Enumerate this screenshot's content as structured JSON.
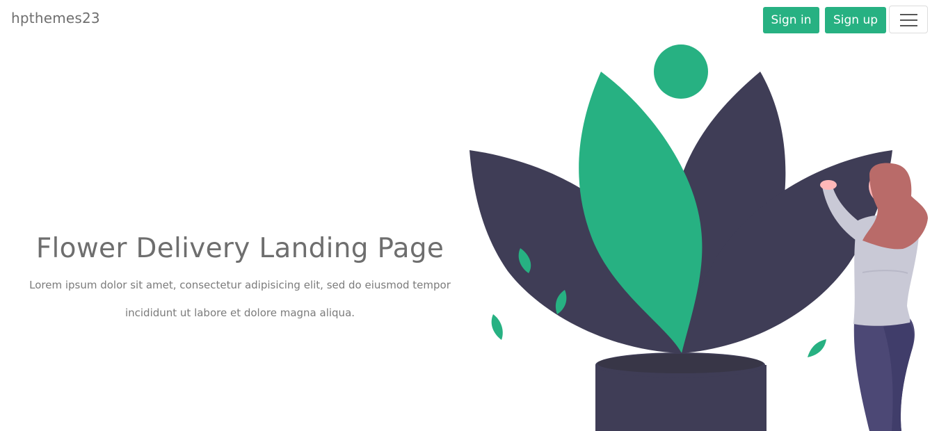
{
  "navbar": {
    "brand": "hpthemes23",
    "signin_label": "Sign in",
    "signup_label": "Sign up",
    "menu_icon": "hamburger-menu-icon"
  },
  "hero": {
    "title": "Flower Delivery Landing Page",
    "subtitle": "Lorem ipsum dolor sit amet, consectetur adipisicing elit, sed do eiusmod tempor incididunt ut labore et dolore magna aliqua."
  },
  "colors": {
    "accent": "#27b182",
    "dark": "#3f3d56",
    "text": "#6e6e6e",
    "hair": "#b96b69",
    "shirt": "#c9c9d6",
    "pants": "#4c4875"
  }
}
